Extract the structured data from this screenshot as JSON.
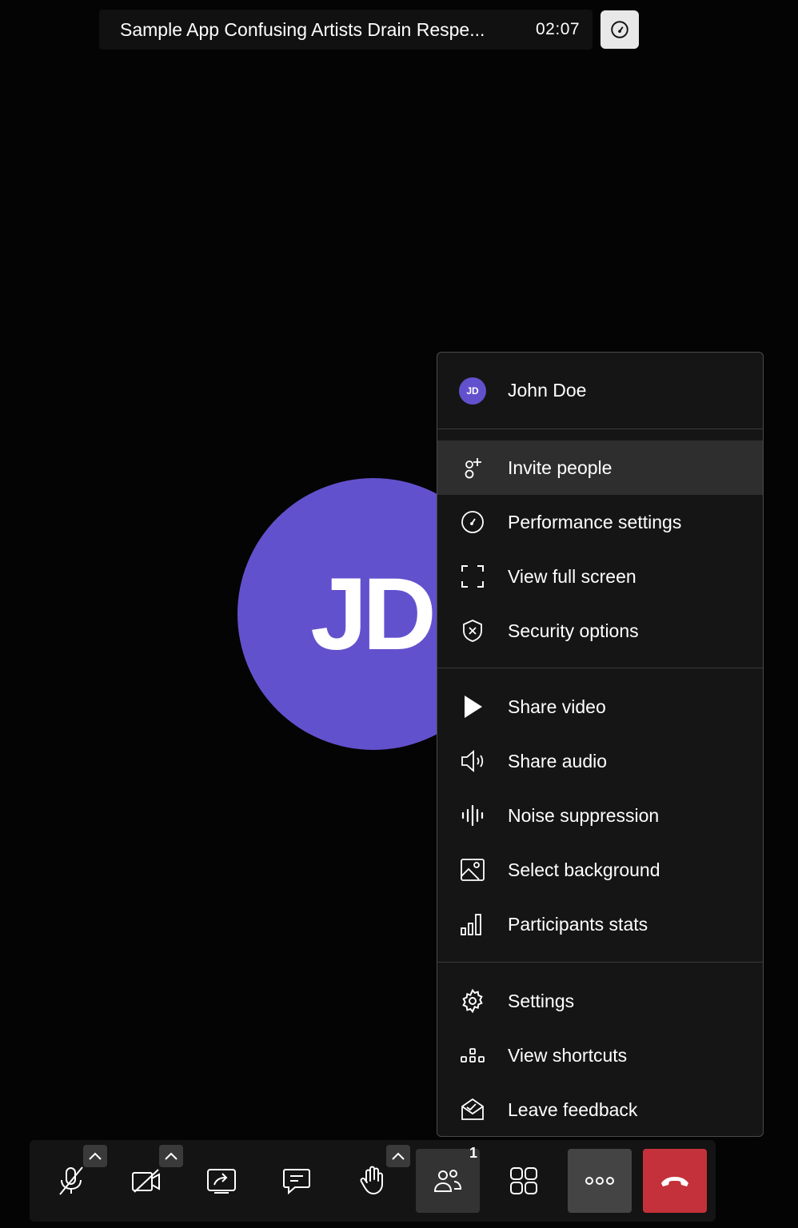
{
  "meeting": {
    "title": "Sample App Confusing Artists Drain Respe...",
    "timer": "02:07"
  },
  "participant": {
    "initials": "JD"
  },
  "menu": {
    "user": {
      "initials": "JD",
      "name": "John Doe"
    },
    "items": [
      {
        "label": "Invite people",
        "icon": "invite-person-icon"
      },
      {
        "label": "Performance settings",
        "icon": "speedometer-icon"
      },
      {
        "label": "View full screen",
        "icon": "fullscreen-icon"
      },
      {
        "label": "Security options",
        "icon": "shield-icon"
      },
      {
        "label": "Share video",
        "icon": "play-icon"
      },
      {
        "label": "Share audio",
        "icon": "speaker-icon"
      },
      {
        "label": "Noise suppression",
        "icon": "waveform-icon"
      },
      {
        "label": "Select background",
        "icon": "image-icon"
      },
      {
        "label": "Participants stats",
        "icon": "bar-chart-icon"
      },
      {
        "label": "Settings",
        "icon": "gear-icon"
      },
      {
        "label": "View shortcuts",
        "icon": "keyboard-shortcuts-icon"
      },
      {
        "label": "Leave feedback",
        "icon": "envelope-feedback-icon"
      }
    ]
  },
  "toolbar": {
    "participants_count": "1",
    "hangup_color": "#c4313a"
  },
  "colors": {
    "avatar": "#6251cd",
    "menu_bg": "#151515",
    "hover": "#2e2e2e"
  }
}
